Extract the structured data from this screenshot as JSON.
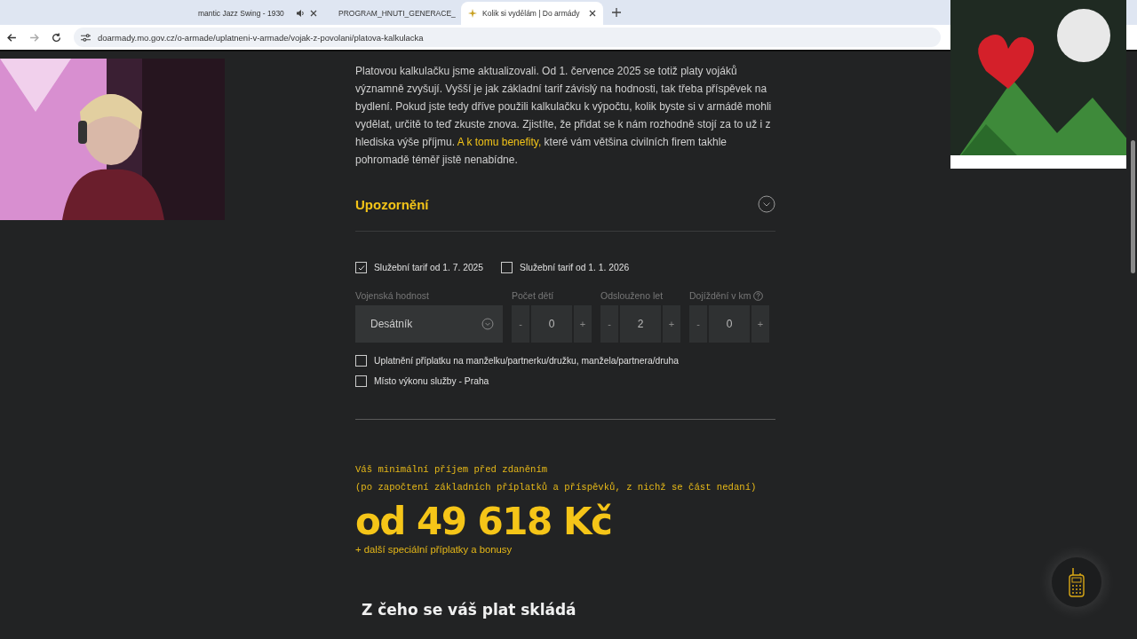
{
  "browser": {
    "tabs": [
      {
        "title": "mantic Jazz Swing - 1930",
        "selected": false,
        "audio": true
      },
      {
        "title": "PROGRAM_HNUTI_GENERACE_",
        "selected": false,
        "audio": false
      },
      {
        "title": "Kolik si vydělám | Do armády",
        "selected": true,
        "audio": false
      }
    ],
    "url": "doarmady.mo.gov.cz/o-armade/uplatneni-v-armade/vojak-z-povolani/platova-kalkulacka"
  },
  "article": {
    "paragraph": "Platovou kalkulačku jsme aktualizovali. Od 1. července 2025 se totiž platy vojáků významně zvyšují. Vyšší je jak základní tarif závislý na hodnosti, tak třeba příspěvek na bydlení. Pokud jste tedy dříve použili kalkulačku k výpočtu, kolik byste si v armádě mohli vydělat, určitě to teď zkuste znova. Zjistíte, že přidat se k nám rozhodně stojí za to už i z hlediska výše příjmu.",
    "link": "A k tomu benefity,",
    "paragraph_end": "které vám většina civilních firem takhle pohromadě téměř jistě nenabídne."
  },
  "accordion": {
    "title": "Upozornění",
    "expanded": false
  },
  "tariffs": [
    {
      "label": "Služební tarif od 1. 7. 2025",
      "checked": true
    },
    {
      "label": "Služební tarif od 1. 1. 2026",
      "checked": false
    }
  ],
  "rank": {
    "label": "Vojenská hodnost",
    "value": "Desátník"
  },
  "steppers": [
    {
      "label": "Počet dětí",
      "minus": "-",
      "value": "0",
      "plus": "+",
      "help": false
    },
    {
      "label": "Odslouženo let",
      "minus": "-",
      "value": "2",
      "plus": "+",
      "help": false
    },
    {
      "label": "Dojíždění v km",
      "minus": "-",
      "value": "0",
      "plus": "+",
      "help": true
    }
  ],
  "options": [
    {
      "label": "Uplatnění příplatku na manželku/partnerku/družku, manžela/partnera/druha",
      "checked": false
    },
    {
      "label": "Místo výkonu služby - Praha",
      "checked": false
    }
  ],
  "result": {
    "caption": "Váš minimální příjem před zdaněním",
    "note": "(po započtení základních příplatků a příspěvků, z nichž se část nedaní)",
    "amount": "od 49 618 Kč",
    "extra": "+ další speciální příplatky a bonusy"
  },
  "section_heading": "Z čeho se váš plat skládá"
}
